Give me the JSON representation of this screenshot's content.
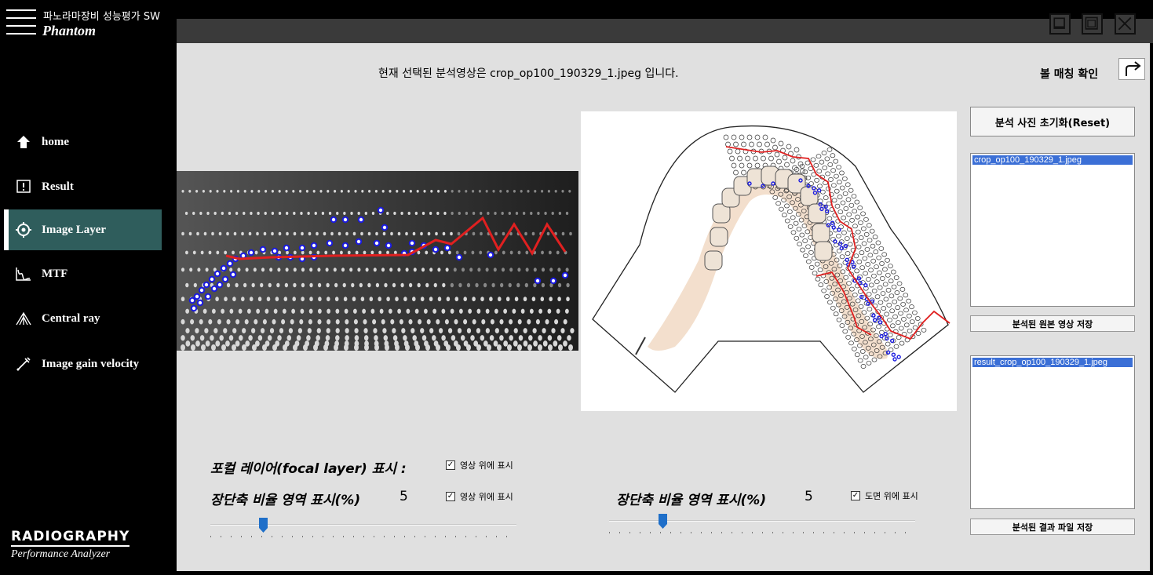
{
  "app": {
    "subtitle": "파노라마장비 성능평가 SW",
    "title": "Phantom",
    "brand_main": "RADIOGRAPHY",
    "brand_sub": "Performance Analyzer"
  },
  "nav": {
    "items": [
      {
        "label": "home",
        "icon": "home-icon"
      },
      {
        "label": "Result",
        "icon": "info-icon"
      },
      {
        "label": "Image Layer",
        "icon": "target-icon",
        "active": true
      },
      {
        "label": "MTF",
        "icon": "mtf-graph-icon"
      },
      {
        "label": "Central ray",
        "icon": "central-ray-icon"
      },
      {
        "label": "Image gain velocity",
        "icon": "pen-icon"
      }
    ]
  },
  "window": {
    "buttons": [
      "minimize",
      "maximize",
      "close"
    ]
  },
  "main": {
    "selected_text": "현재 선택된 분석영상은 crop_op100_190329_1.jpeg 입니다.",
    "ball_check_label": "볼 매칭 확인",
    "reset_button": "분석 사진 초기화(Reset)",
    "original_list": [
      "crop_op100_190329_1.jpeg"
    ],
    "save_original_button": "분석된 원본 영상 저장",
    "result_list": [
      "result_crop_op100_190329_1.jpeg"
    ],
    "save_result_button": "분석된 결과 파일 저장",
    "focal_layer_label": "포컬 레이어(focal layer) 표시 :",
    "focal_layer_checkbox": "영상 위에 표시",
    "ratio_label_left": "장단축 비율 영역 표시(%)",
    "ratio_value_left": "5",
    "ratio_checkbox_left": "영상 위에 표시",
    "ratio_label_right": "장단축 비율 영역 표시(%)",
    "ratio_value_right": "5",
    "ratio_checkbox_right": "도면 위에 표시",
    "slider_left_value": 5,
    "slider_right_value": 5
  },
  "colors": {
    "accent_nav": "#2f5d5c",
    "list_highlight": "#3b6fd6",
    "focal_line": "#e02020",
    "ball_marker": "#1a1ae0",
    "slider_thumb": "#1f6fc9"
  }
}
